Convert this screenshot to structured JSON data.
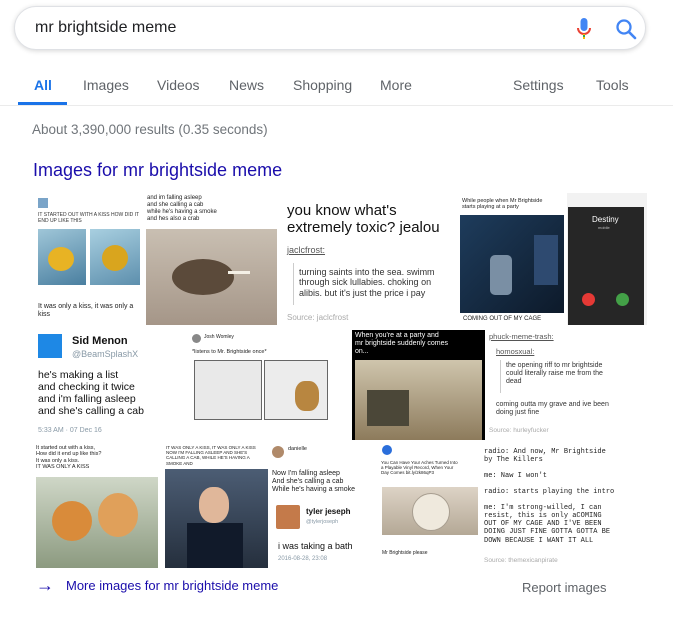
{
  "search": {
    "query": "mr brightside meme"
  },
  "tabs": [
    {
      "label": "All"
    },
    {
      "label": "Images"
    },
    {
      "label": "Videos"
    },
    {
      "label": "News"
    },
    {
      "label": "Shopping"
    },
    {
      "label": "More"
    },
    {
      "label": "Settings"
    },
    {
      "label": "Tools"
    }
  ],
  "result_stats": "About 3,390,000 results (0.35 seconds)",
  "images_heading": "Images for mr brightside meme",
  "tiles": {
    "fish": {
      "header": "IT STARTED OUT WITH A KISS HOW DID IT\nEND UP LIKE THIS",
      "caption": "It was only a kiss, it was only a\nkiss"
    },
    "crab": {
      "caption": "and im falling asleep\nand she calling a cab\nwhile he's having a smoke\nand hes also a crab"
    },
    "toxic": {
      "heading": "you know what's\nextremely toxic? jealou",
      "user": "jaclcfrost:",
      "quote": "turning saints into the sea. swimm\nthrough sick lullabies. choking on\nalibis. but it's just the price i pay",
      "source": "Source: jaclcfrost"
    },
    "party": {
      "caption": "While people when Mr Brightside\nstarts playing at a party",
      "footer": "COMING OUT OF MY CAGE"
    },
    "destiny": {
      "name": "Destiny",
      "status": "mobile"
    },
    "sid": {
      "name": "Sid Menon",
      "handle": "@BeamSplashX",
      "body": "he's making a list\nand checking it twice\nand i'm falling asleep\nand she's calling a cab",
      "time": "5:33 AM · 07 Dec 16"
    },
    "kennels": {
      "user": "Josh Womley",
      "text": "*listens to Mr. Brightside once*"
    },
    "army": {
      "caption": "When you're at a party and\nmr brightside suddenly comes\non..."
    },
    "trash": {
      "user": "phuck-meme-trash:",
      "user2": "homosxual:",
      "quote": "the opening riff to mr brightside\ncould literally raise me from the\ndead",
      "reply": "coming outta my grave and ive been\ndoing just fine",
      "source": "Source: hurleyfucker"
    },
    "shiba": {
      "caption": "It started out with a kiss,\nHow did it end up like this?\nIt was only a kiss.\nIT WAS ONLY A KISS"
    },
    "cruz": {
      "caption": "IT WAS ONLY A KISS, IT WAS ONLY A KISS\nNOW I'M FALLING ASLEEP AND SHE'S\nCALLING A CAB, WHILE HE'S HAVING A\nSMOKE AND"
    },
    "danielle": {
      "user": "danielle",
      "body": "Now I'm falling asleep\nAnd she's calling a cab\nWhile he's having a smoke",
      "user2": "tyler jeseph",
      "handle2": "@tylerjoseph",
      "reply": "i was taking a bath",
      "time": "2016-08-28, 23:08"
    },
    "vinyl": {
      "caption": "You Can Have Your Aches Turned Into\na Playable Vinyl Record, When Your\nDay Comes bit.ly/2k86qP3",
      "footer": "Mr Brightside please"
    },
    "radio": {
      "text": "radio: And now, Mr Brightside\nby The Killers\n\nme: Naw I won't\n\nradio: starts playing the intro\n\nme: I'm strong-willed, I can\nresist, this is only aCOMING\nOUT OF MY CAGE AND I'VE BEEN\nDOING JUST FINE GOTTA GOTTA BE\nDOWN BECAUSE I WANT IT ALL",
      "source": "Source: themexicanpirate"
    }
  },
  "more_images": "More images for mr brightside meme",
  "report_images": "Report images"
}
